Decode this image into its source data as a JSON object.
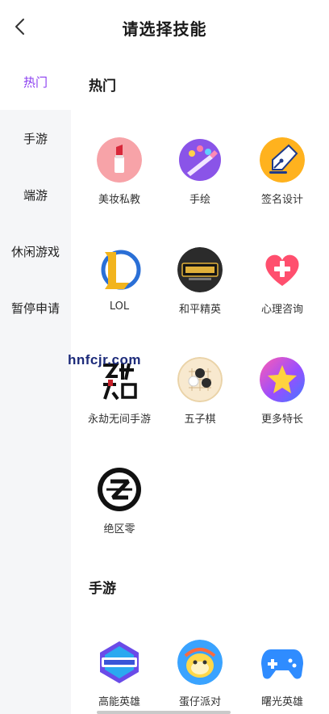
{
  "header": {
    "title": "请选择技能",
    "back_icon": "chevron-left-icon"
  },
  "sidebar": {
    "items": [
      {
        "label": "热门",
        "active": true
      },
      {
        "label": "手游",
        "active": false
      },
      {
        "label": "端游",
        "active": false
      },
      {
        "label": "休闲游戏",
        "active": false
      },
      {
        "label": "暂停申请",
        "active": false
      }
    ],
    "accent_color": "#8a3df0"
  },
  "sections": [
    {
      "title": "热门",
      "skills": [
        {
          "label": "美妆私教",
          "icon": "lipstick-icon"
        },
        {
          "label": "手绘",
          "icon": "paint-palette-icon"
        },
        {
          "label": "签名设计",
          "icon": "pen-nib-icon"
        },
        {
          "label": "LOL",
          "icon": "lol-logo-icon"
        },
        {
          "label": "和平精英",
          "icon": "peace-elite-logo-icon"
        },
        {
          "label": "心理咨询",
          "icon": "heart-plus-icon"
        },
        {
          "label": "永劫无间手游",
          "icon": "naraka-logo-icon"
        },
        {
          "label": "五子棋",
          "icon": "gomoku-board-icon"
        },
        {
          "label": "更多特长",
          "icon": "star-icon"
        },
        {
          "label": "绝区零",
          "icon": "zzz-logo-icon"
        }
      ]
    },
    {
      "title": "手游",
      "skills": [
        {
          "label": "高能英雄",
          "icon": "high-energy-heroes-logo-icon"
        },
        {
          "label": "蛋仔派对",
          "icon": "eggy-party-icon"
        },
        {
          "label": "曙光英雄",
          "icon": "gamepad-icon"
        }
      ]
    }
  ],
  "watermark": {
    "text": "hnfcjr.com"
  }
}
